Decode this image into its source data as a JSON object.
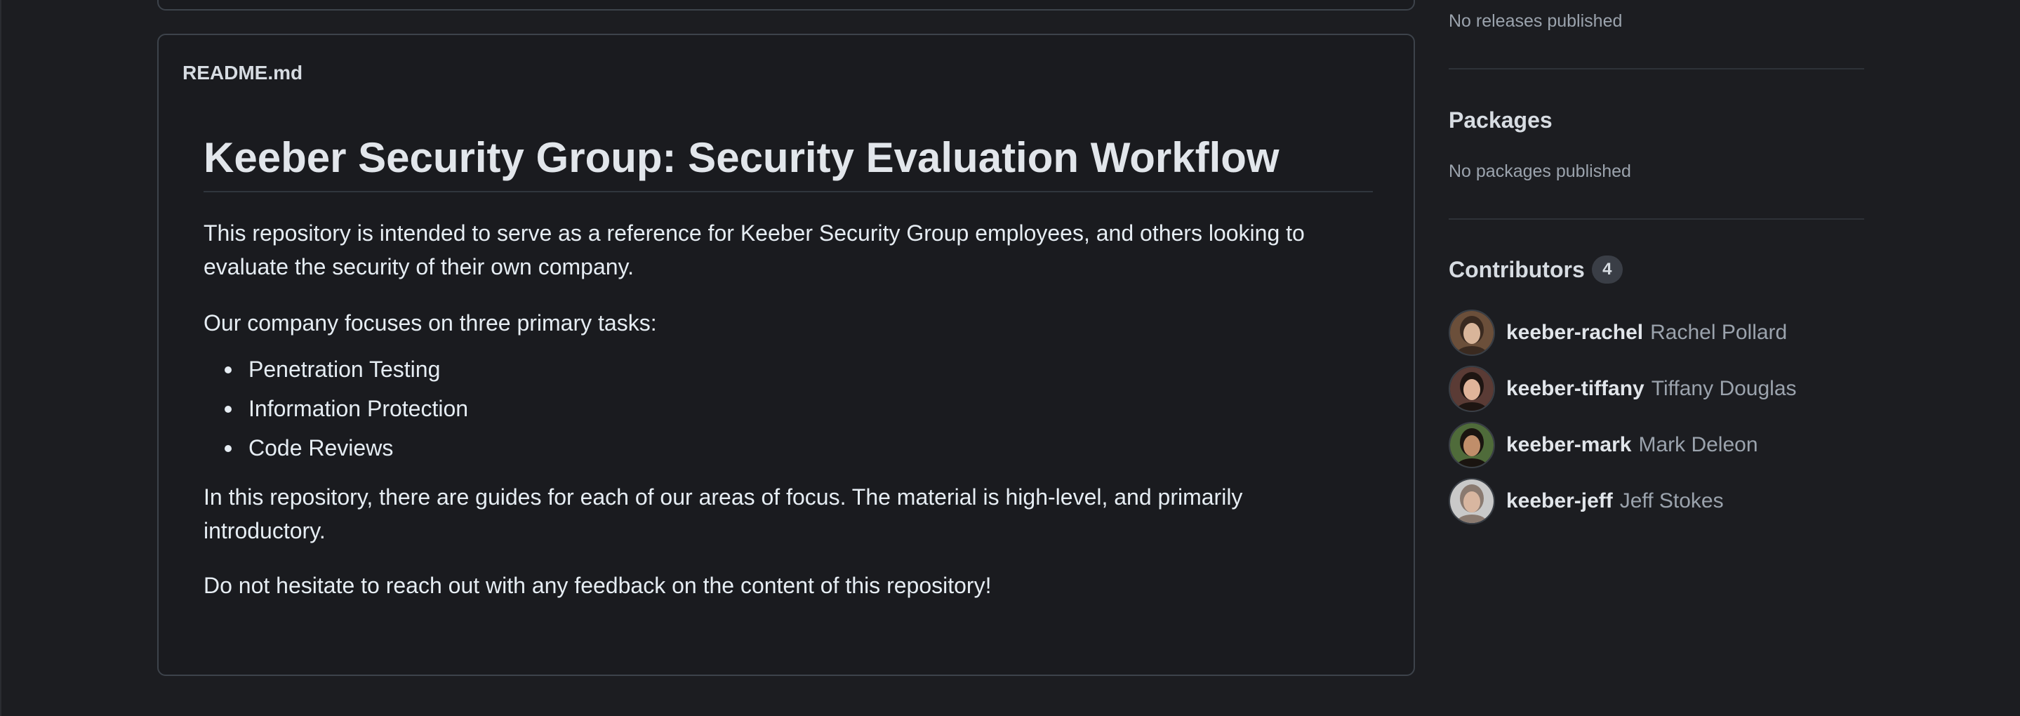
{
  "readme": {
    "filename": "README.md",
    "title": "Keeber Security Group: Security Evaluation Workflow",
    "intro": "This repository is intended to serve as a reference for Keeber Security Group employees, and others looking to evaluate the security of their own company.",
    "focus_lead": "Our company focuses on three primary tasks:",
    "tasks": [
      "Penetration Testing",
      "Information Protection",
      "Code Reviews"
    ],
    "guides": "In this repository, there are guides for each of our areas of focus. The material is high-level, and primarily introductory.",
    "feedback": "Do not hesitate to reach out with any feedback on the content of this repository!"
  },
  "sidebar": {
    "releases_empty": "No releases published",
    "packages_heading": "Packages",
    "packages_empty": "No packages published",
    "contributors_heading": "Contributors",
    "contributors_count": "4",
    "contributors": [
      {
        "login": "keeber-rachel",
        "name": "Rachel Pollard",
        "avatar_icon": "avatar-rachel",
        "bg": "#6b4f3a",
        "skin": "#d9b59a",
        "hair": "#3a2a20"
      },
      {
        "login": "keeber-tiffany",
        "name": "Tiffany Douglas",
        "avatar_icon": "avatar-tiffany",
        "bg": "#5a3b35",
        "skin": "#e0b49a",
        "hair": "#1e1512"
      },
      {
        "login": "keeber-mark",
        "name": "Mark Deleon",
        "avatar_icon": "avatar-mark",
        "bg": "#4f6b3a",
        "skin": "#c08e6a",
        "hair": "#1a1410"
      },
      {
        "login": "keeber-jeff",
        "name": "Jeff Stokes",
        "avatar_icon": "avatar-jeff",
        "bg": "#c9c9c9",
        "skin": "#d8b6a0",
        "hair": "#8a7a70"
      }
    ]
  }
}
